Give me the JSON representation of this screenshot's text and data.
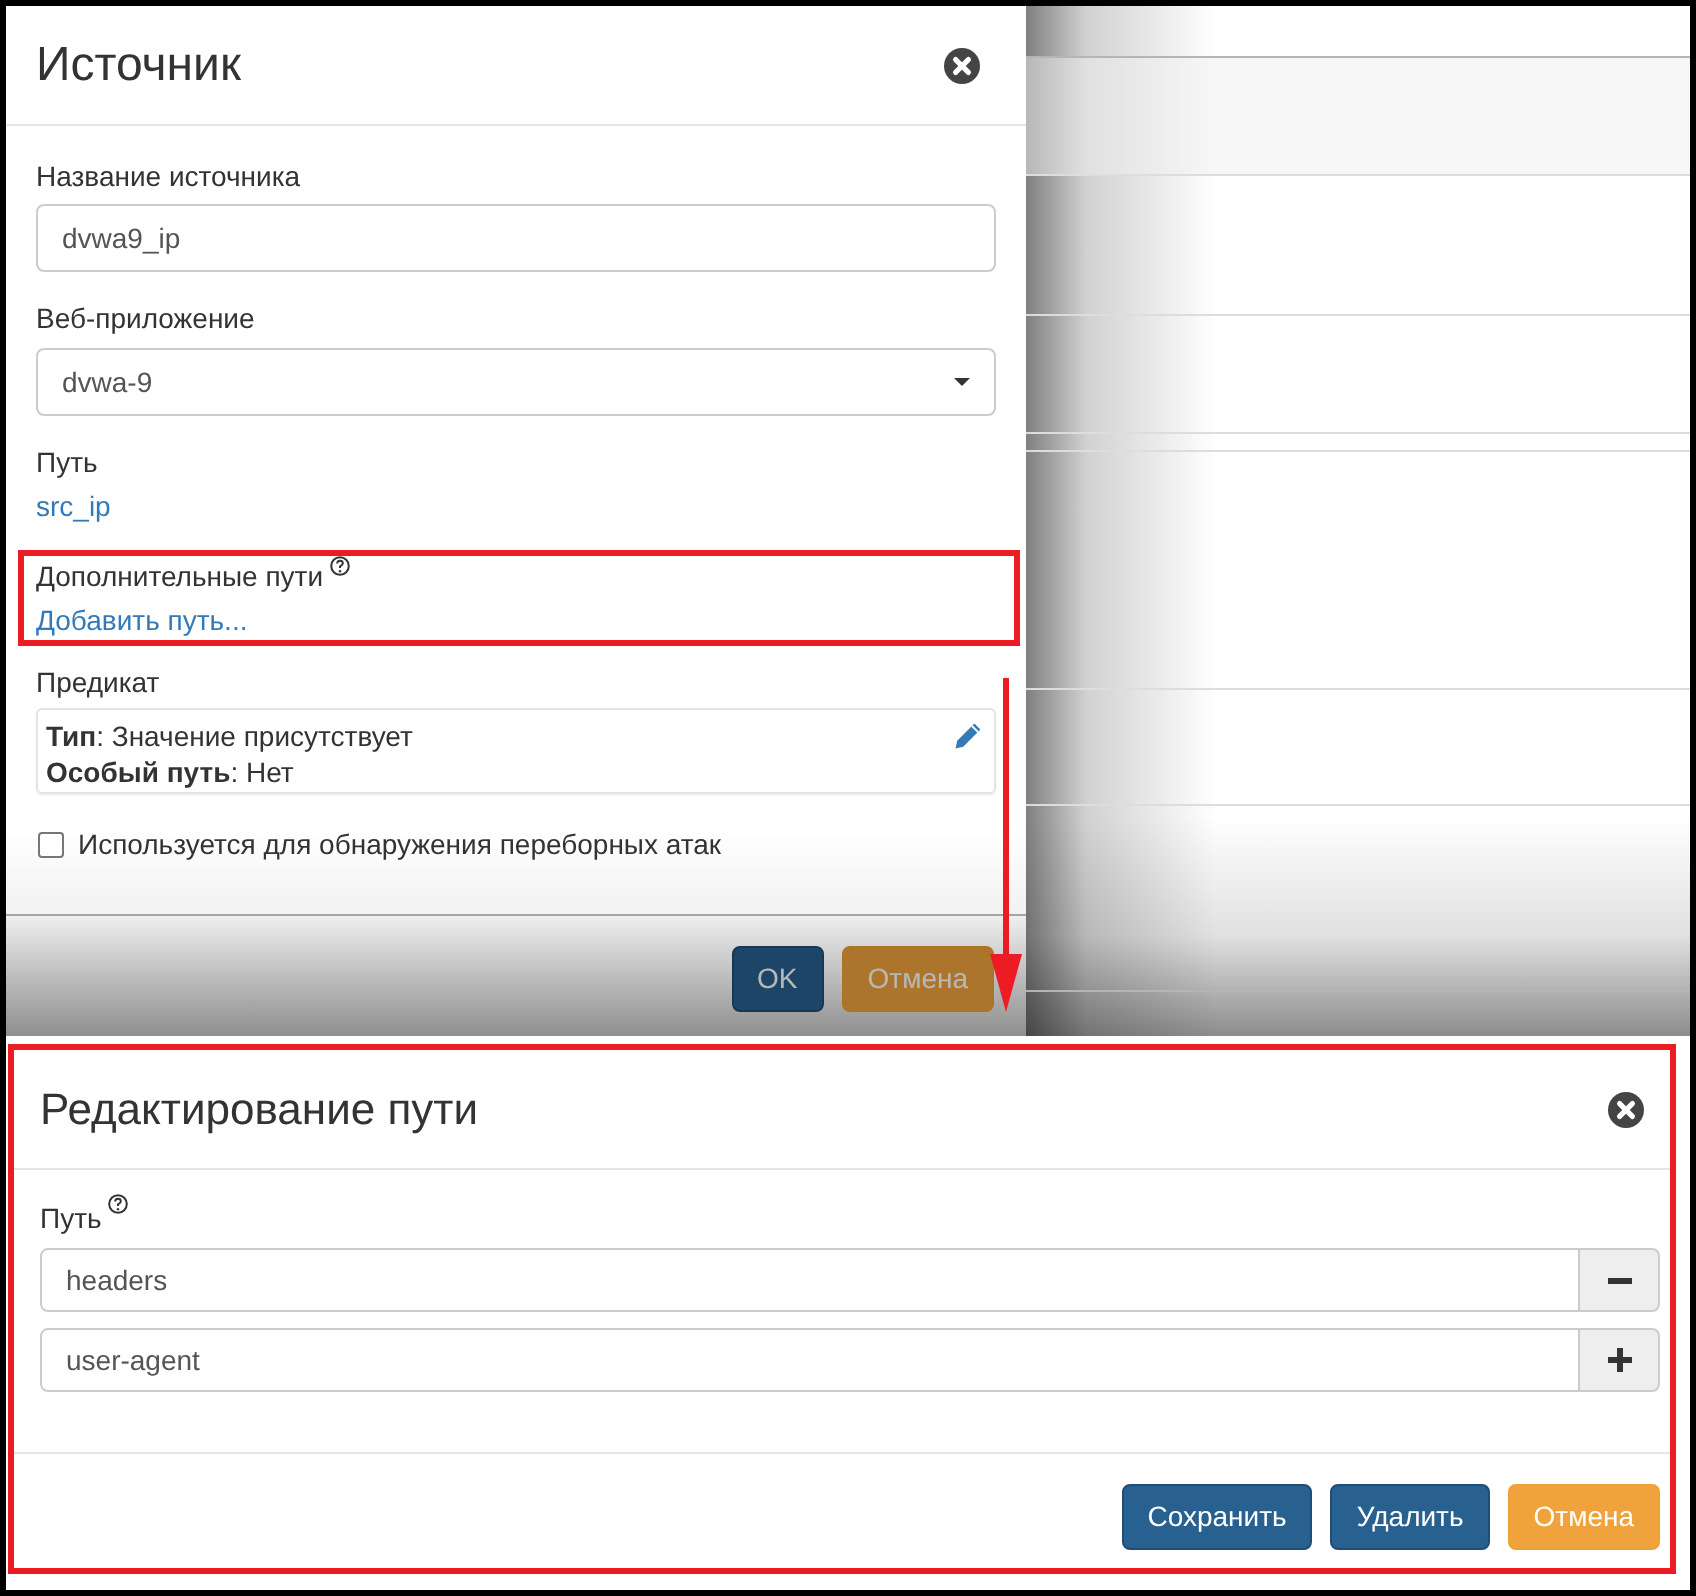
{
  "source_dialog": {
    "title": "Источник",
    "fields": [
      {
        "kind": "input",
        "label": "Название источника",
        "value": "dvwa9_ip"
      },
      {
        "kind": "select",
        "label": "Веб-приложение",
        "value": "dvwa-9"
      },
      {
        "kind": "link",
        "label": "Путь",
        "value": "src_ip"
      }
    ],
    "extra_paths": {
      "label": "Дополнительные пути",
      "link": "Добавить путь...",
      "highlighted": true
    },
    "predicate": {
      "label": "Предикат",
      "lines": [
        "**Тип**: Значение присутствует",
        "**Особый путь**: Нет"
      ]
    },
    "brute_force_checkbox": {
      "label": "Используется для обнаружения переборных атак",
      "checked": false
    },
    "buttons": [
      {
        "label": "OK",
        "kind": "primary"
      },
      {
        "label": "Отмена",
        "kind": "warning"
      }
    ]
  },
  "path_dialog": {
    "title": "Редактирование пути",
    "highlighted": true,
    "label": "Путь",
    "segments": [
      {
        "value": "headers",
        "kind": "remove"
      },
      {
        "value": "user-agent",
        "kind": "add"
      }
    ],
    "buttons": [
      {
        "label": "Сохранить",
        "kind": "primary"
      },
      {
        "label": "Удалить",
        "kind": "primary"
      },
      {
        "label": "Отмена",
        "kind": "warning"
      }
    ]
  }
}
